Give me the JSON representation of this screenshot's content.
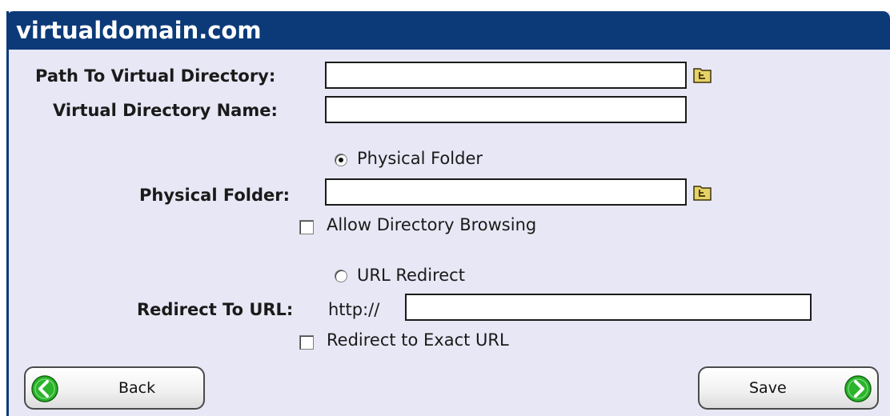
{
  "header": {
    "title": "virtualdomain.com"
  },
  "form": {
    "path_label": "Path To Virtual Directory:",
    "path_value": "",
    "name_label": "Virtual Directory Name:",
    "name_value": "",
    "physical_radio_label": "Physical Folder",
    "physical_radio_selected": true,
    "physical_folder_label": "Physical Folder:",
    "physical_folder_value": "",
    "allow_browsing_label": "Allow Directory Browsing",
    "allow_browsing_checked": false,
    "url_radio_label": "URL Redirect",
    "url_radio_selected": false,
    "redirect_label": "Redirect To URL:",
    "redirect_prefix": "http://",
    "redirect_value": "",
    "exact_url_label": "Redirect to Exact URL",
    "exact_url_checked": false
  },
  "buttons": {
    "back_label": "Back",
    "save_label": "Save"
  },
  "icons": {
    "browse": "folder-browse-icon",
    "back": "left-arrow-icon",
    "save": "right-arrow-icon"
  },
  "colors": {
    "header_bg": "#0c3a78",
    "panel_bg": "#e8e7f5",
    "folder_icon": "#e6d267",
    "arrow_green": "#2bb52b"
  }
}
